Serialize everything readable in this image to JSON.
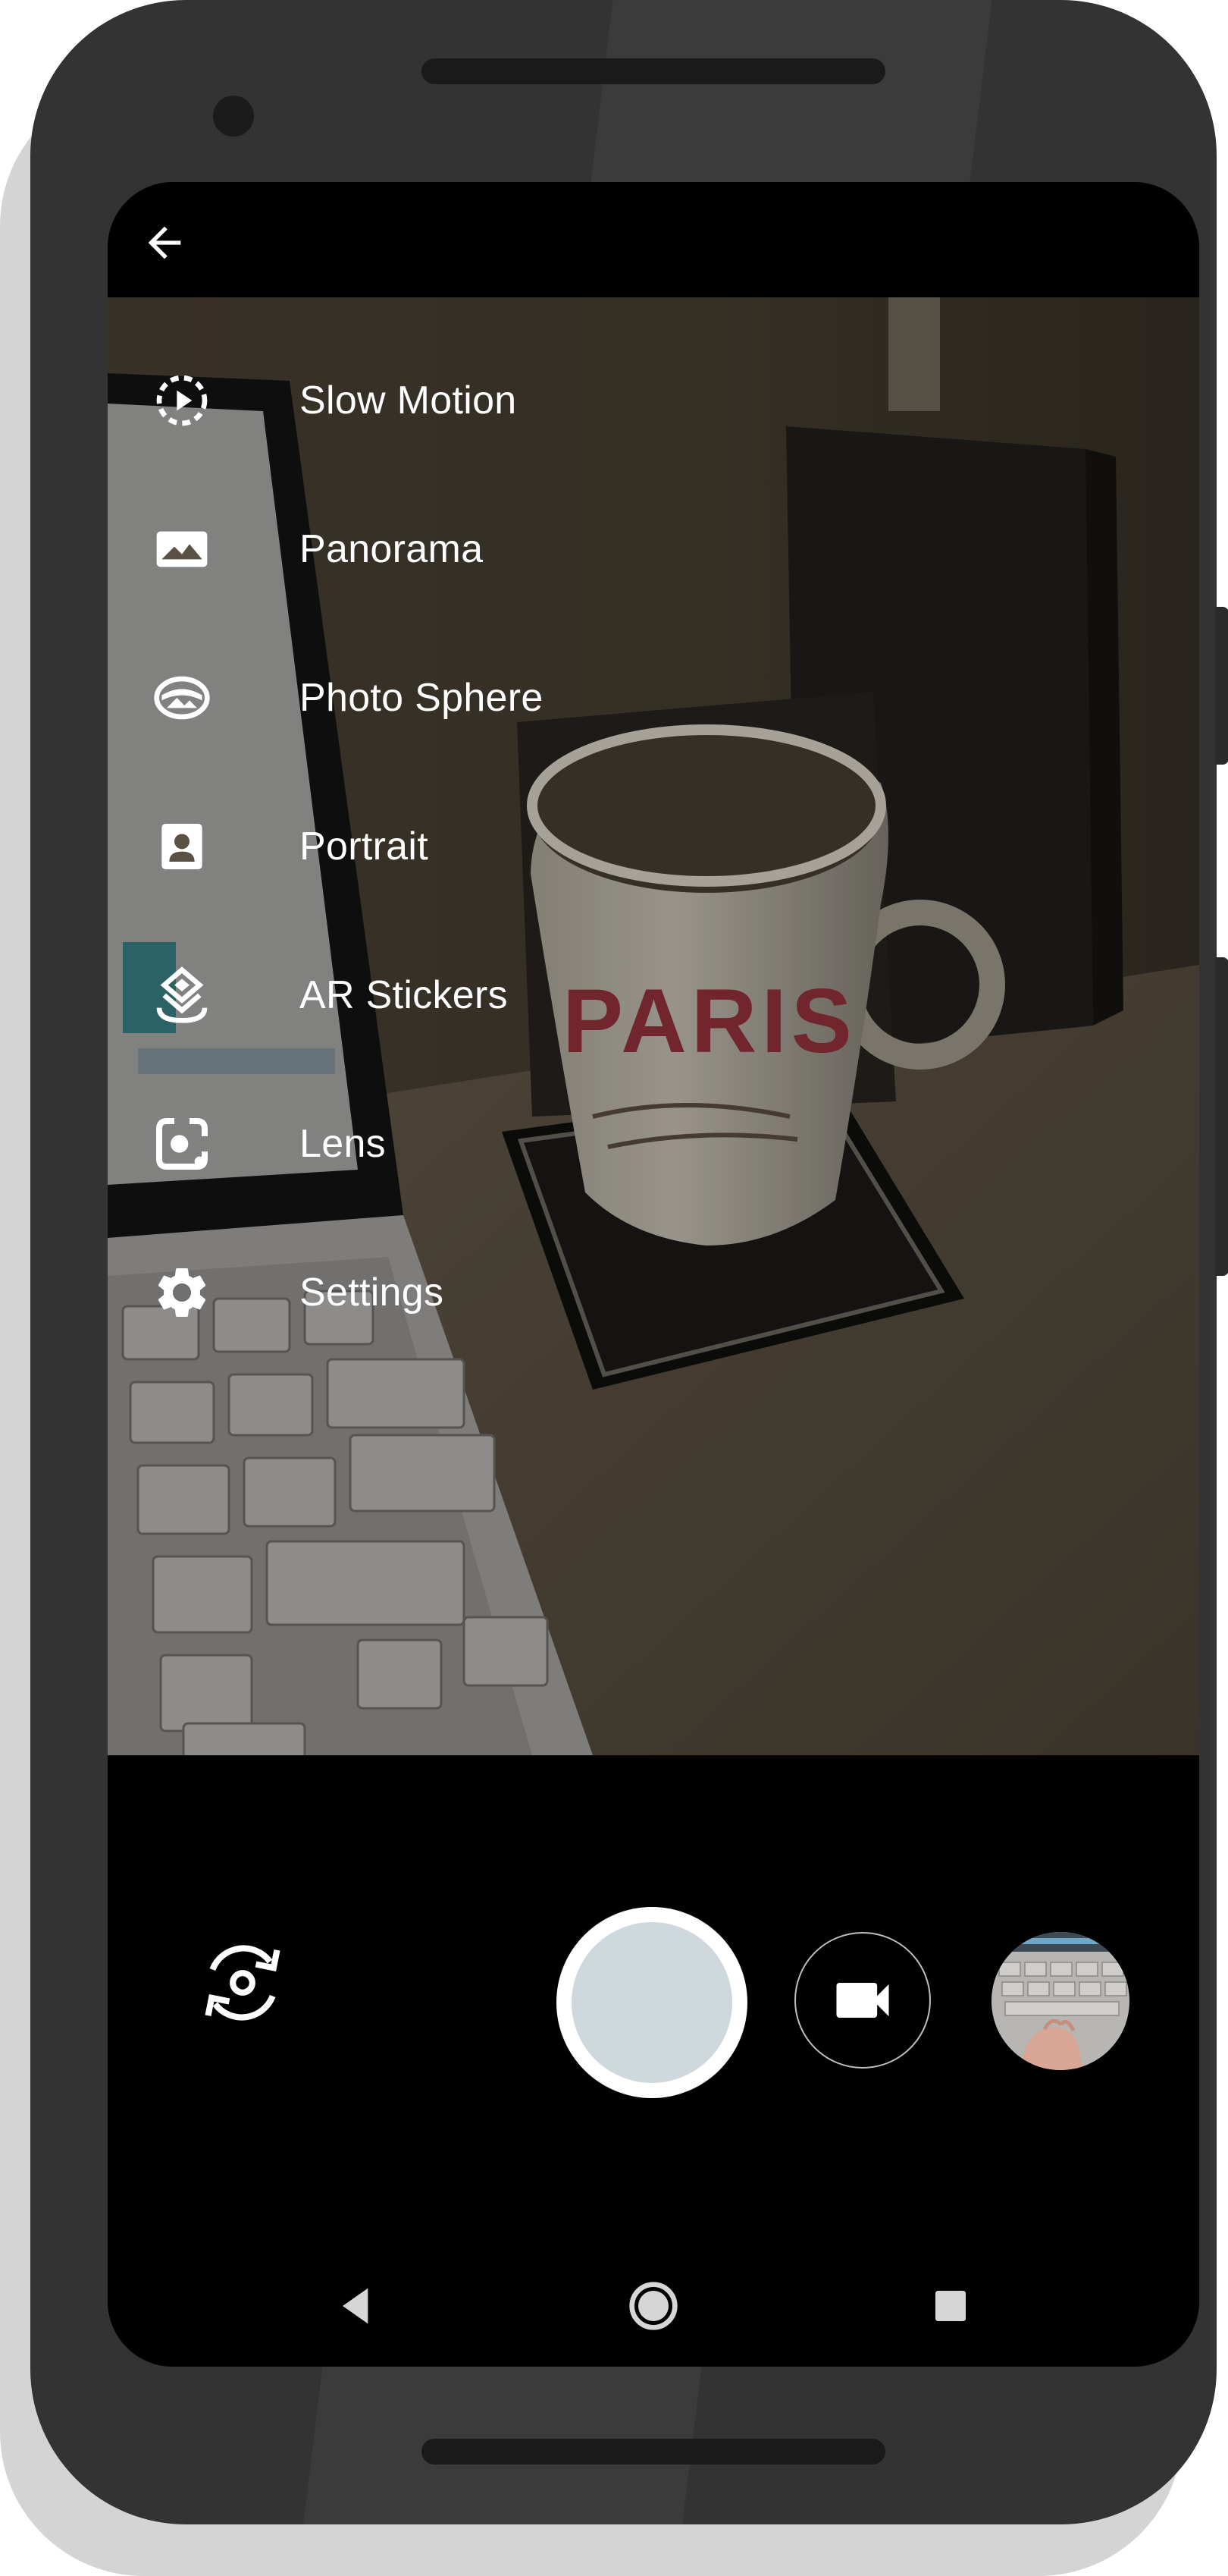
{
  "top_bar": {
    "back_icon": "arrow-back-icon"
  },
  "menu": {
    "items": [
      {
        "id": "slow-motion",
        "label": "Slow Motion",
        "icon": "slow-motion-icon"
      },
      {
        "id": "panorama",
        "label": "Panorama",
        "icon": "panorama-icon"
      },
      {
        "id": "photo-sphere",
        "label": "Photo Sphere",
        "icon": "photo-sphere-icon"
      },
      {
        "id": "portrait",
        "label": "Portrait",
        "icon": "portrait-icon"
      },
      {
        "id": "ar-stickers",
        "label": "AR Stickers",
        "icon": "ar-stickers-icon"
      },
      {
        "id": "lens",
        "label": "Lens",
        "icon": "lens-icon"
      },
      {
        "id": "settings",
        "label": "Settings",
        "icon": "settings-gear-icon"
      }
    ]
  },
  "controls": {
    "switch_camera_icon": "switch-camera-icon",
    "shutter_icon": "shutter-icon",
    "video_icon": "videocam-icon",
    "thumbnail": "last-photo-thumbnail"
  },
  "navbar": {
    "back_icon": "nav-back-icon",
    "home_icon": "nav-home-icon",
    "recents_icon": "nav-recents-icon"
  },
  "viewfinder": {
    "mug_text": "PARIS"
  },
  "colors": {
    "phone_body": "#333333",
    "screen_bar": "#000000",
    "menu_text": "#ffffff",
    "shutter_fill": "#cfd8dc"
  }
}
